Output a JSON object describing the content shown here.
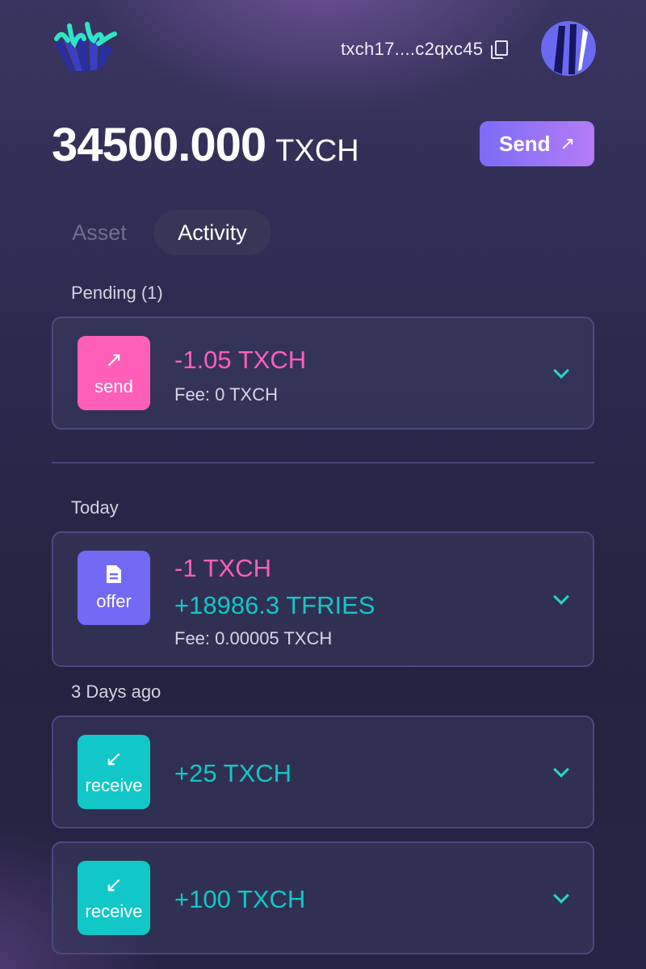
{
  "header": {
    "address": "txch17....c2qxc45",
    "icons": {
      "logo": "goby-logo",
      "copy": "copy-icon",
      "avatar": "wallet-avatar"
    }
  },
  "balance": {
    "amount": "34500.000",
    "unit": "TXCH"
  },
  "send_button": {
    "label": "Send",
    "icon": "↗"
  },
  "tabs": [
    {
      "label": "Asset",
      "active": false
    },
    {
      "label": "Activity",
      "active": true
    }
  ],
  "pending": {
    "label": "Pending (1)",
    "items": [
      {
        "type": "send",
        "icon": "↗",
        "amounts": [
          "-1.05 TXCH"
        ],
        "fee": "Fee: 0 TXCH"
      }
    ]
  },
  "today": {
    "label": "Today",
    "items": [
      {
        "type": "offer",
        "icon": "document-icon",
        "amounts": [
          "-1 TXCH",
          "+18986.3 TFRIES"
        ],
        "fee": "Fee: 0.00005 TXCH"
      }
    ]
  },
  "three_days": {
    "label": "3 Days ago",
    "items": [
      {
        "type": "receive",
        "icon": "↙",
        "amounts": [
          "+25 TXCH"
        ]
      },
      {
        "type": "receive",
        "icon": "↙",
        "amounts": [
          "+100 TXCH"
        ]
      }
    ]
  },
  "colors": {
    "negative": "#ff5fb8",
    "positive": "#12c7c7",
    "send_badge": "#ff5fb8",
    "offer_badge": "#7269f4",
    "receive_badge": "#12c7c7",
    "accent_start": "#7b6cf6",
    "accent_end": "#b57cf5"
  }
}
